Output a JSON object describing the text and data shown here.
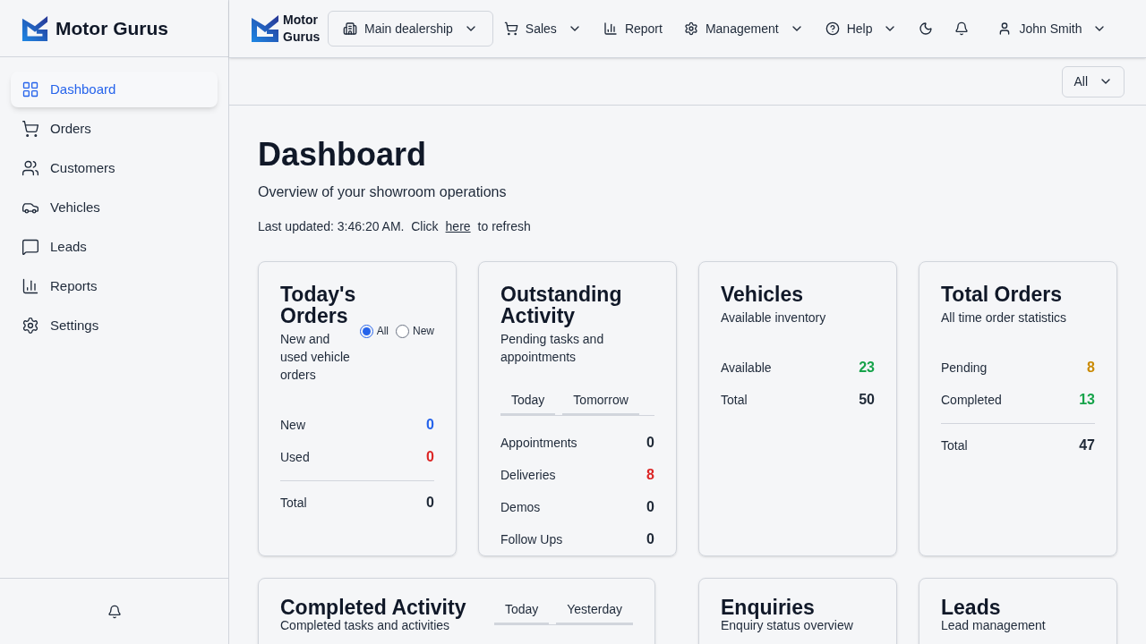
{
  "brand": {
    "name": "Motor Gurus",
    "header_name": "Motor Gurus"
  },
  "sidebar": {
    "items": [
      {
        "label": "Dashboard",
        "selected": true
      },
      {
        "label": "Orders",
        "selected": false
      },
      {
        "label": "Customers",
        "selected": false
      },
      {
        "label": "Vehicles",
        "selected": false
      },
      {
        "label": "Leads",
        "selected": false
      },
      {
        "label": "Reports",
        "selected": false
      },
      {
        "label": "Settings",
        "selected": false
      }
    ]
  },
  "topbar": {
    "dealership": {
      "label": "Main dealership"
    },
    "nav": [
      {
        "label": "Sales",
        "dropdown": true
      },
      {
        "label": "Report",
        "dropdown": false
      },
      {
        "label": "Management",
        "dropdown": true
      },
      {
        "label": "Help",
        "dropdown": true
      }
    ],
    "user": {
      "name": "John Smith"
    }
  },
  "filter": {
    "value": "All"
  },
  "page": {
    "title": "Dashboard",
    "subtitle": "Overview of your showroom operations",
    "updated_prefix": "Last updated: 3:46:20 AM.  Click",
    "refresh_link": "here",
    "updated_suffix": "to refresh"
  },
  "cards": [
    {
      "title": "Today's Orders",
      "subtitle": "New and used vehicle orders",
      "radios": [
        {
          "label": "All",
          "selected": true
        },
        {
          "label": "New",
          "selected": false
        }
      ],
      "rows": [
        {
          "kind": "stat",
          "label": "New",
          "value": "0",
          "color": "#2563eb"
        },
        {
          "kind": "stat",
          "label": "Used",
          "value": "0",
          "color": "#dc2626"
        },
        {
          "kind": "total",
          "label": "Total",
          "value": "0",
          "color": "#1f2937"
        }
      ]
    },
    {
      "title": "Outstanding Activity",
      "subtitle": "Pending tasks and appointments",
      "tabs": [
        {
          "label": "Today"
        },
        {
          "label": "Tomorrow"
        }
      ],
      "rows": [
        {
          "kind": "stat",
          "label": "Appointments",
          "value": "0",
          "color": "#1f2937"
        },
        {
          "kind": "stat",
          "label": "Deliveries",
          "value": "8",
          "color": "#dc2626"
        },
        {
          "kind": "stat",
          "label": "Demos",
          "value": "0",
          "color": "#1f2937"
        },
        {
          "kind": "stat",
          "label": "Follow Ups",
          "value": "0",
          "color": "#1f2937"
        }
      ]
    },
    {
      "title": "Vehicles",
      "subtitle": "Available inventory",
      "rows": [
        {
          "kind": "stat",
          "label": "Available",
          "value": "23",
          "color": "#16a34a"
        },
        {
          "kind": "stat",
          "label": "Total",
          "value": "50",
          "color": "#1f2937"
        }
      ]
    },
    {
      "title": "Total Orders",
      "subtitle": "All time order statistics",
      "rows": [
        {
          "kind": "stat",
          "label": "Pending",
          "value": "8",
          "color": "#ca8a04"
        },
        {
          "kind": "stat",
          "label": "Completed",
          "value": "13",
          "color": "#16a34a"
        },
        {
          "kind": "total",
          "label": "Total",
          "value": "47",
          "color": "#1f2937"
        }
      ]
    }
  ],
  "bottom_cards": [
    {
      "title": "Completed Activity",
      "subtitle": "Completed tasks and activities",
      "tabs": [
        {
          "label": "Today"
        },
        {
          "label": "Yesterday"
        }
      ]
    },
    {
      "title": "Enquiries",
      "subtitle": "Enquiry status overview"
    },
    {
      "title": "Leads",
      "subtitle": "Lead management"
    }
  ]
}
